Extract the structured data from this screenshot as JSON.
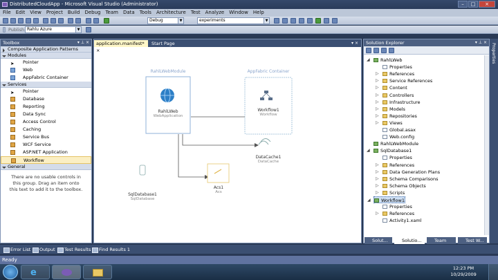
{
  "window": {
    "title": "DistributedCloudApp - Microsoft Visual Studio (Administrator)"
  },
  "menu": [
    "File",
    "Edit",
    "View",
    "Project",
    "Build",
    "Debug",
    "Team",
    "Data",
    "Tools",
    "Architecture",
    "Test",
    "Analyze",
    "Window",
    "Help"
  ],
  "toolbar": {
    "config": "Debug",
    "platform": "experiments",
    "publish_label": "Publish",
    "target": "Rahlu Azure"
  },
  "toolbox": {
    "title": "Toolbox",
    "sections": [
      {
        "label": "Composite Application Patterns",
        "open": false
      },
      {
        "label": "Modules",
        "open": true,
        "items": [
          "Pointer",
          "Web",
          "AppFabric Container"
        ]
      },
      {
        "label": "Services",
        "open": true,
        "items": [
          "Pointer",
          "Database",
          "Reporting",
          "Data Sync",
          "Access Control",
          "Caching",
          "Service Bus",
          "WCF Service",
          "ASP.NET Application",
          "Workflow"
        ]
      },
      {
        "label": "General",
        "open": true
      }
    ],
    "selected": "Workflow",
    "empty_note": "There are no usable controls in this group. Drag an item onto this text to add it to the toolbox."
  },
  "editor": {
    "tabs": [
      "application.manifest*",
      "Start Page"
    ],
    "module_label": "RahlLWebModule",
    "container_label": "AppFabric Container",
    "nodes": {
      "web": {
        "name": "RahlLWeb",
        "sub": "WebApplication"
      },
      "workflow": {
        "name": "Workflow1",
        "sub": "Workflow"
      },
      "cache": {
        "name": "DataCache1",
        "sub": "DataCache"
      },
      "acs": {
        "name": "Acs1",
        "sub": "Acs"
      },
      "sql": {
        "name": "SqlDatabase1",
        "sub": "SqlDatabase"
      }
    }
  },
  "solution": {
    "title": "Solution Explorer",
    "items": [
      {
        "label": "RahlLWeb",
        "level": 0,
        "type": "proj"
      },
      {
        "label": "Properties",
        "level": 1,
        "type": "file"
      },
      {
        "label": "References",
        "level": 1,
        "type": "fold"
      },
      {
        "label": "Service References",
        "level": 1,
        "type": "fold"
      },
      {
        "label": "Content",
        "level": 1,
        "type": "fold"
      },
      {
        "label": "Controllers",
        "level": 1,
        "type": "fold"
      },
      {
        "label": "Infrastructure",
        "level": 1,
        "type": "fold"
      },
      {
        "label": "Models",
        "level": 1,
        "type": "fold"
      },
      {
        "label": "Repositories",
        "level": 1,
        "type": "fold"
      },
      {
        "label": "Views",
        "level": 1,
        "type": "fold"
      },
      {
        "label": "Global.asax",
        "level": 1,
        "type": "file"
      },
      {
        "label": "Web.config",
        "level": 1,
        "type": "file"
      },
      {
        "label": "RahlLWebModule",
        "level": 0,
        "type": "proj"
      },
      {
        "label": "SqlDatabase1",
        "level": 0,
        "type": "proj"
      },
      {
        "label": "Properties",
        "level": 1,
        "type": "file"
      },
      {
        "label": "References",
        "level": 1,
        "type": "fold"
      },
      {
        "label": "Data Generation Plans",
        "level": 1,
        "type": "fold"
      },
      {
        "label": "Schema Comparisons",
        "level": 1,
        "type": "fold"
      },
      {
        "label": "Schema Objects",
        "level": 1,
        "type": "fold"
      },
      {
        "label": "Scripts",
        "level": 1,
        "type": "fold"
      },
      {
        "label": "Workflow1",
        "level": 0,
        "type": "proj"
      },
      {
        "label": "Properties",
        "level": 1,
        "type": "file"
      },
      {
        "label": "References",
        "level": 1,
        "type": "fold"
      },
      {
        "label": "Activity1.xaml",
        "level": 1,
        "type": "file"
      }
    ],
    "bottom_tabs": [
      "Solut...",
      "Solutio...",
      "Team E...",
      "Test W..."
    ]
  },
  "right_strip_label": "Properties",
  "bottom_tabs": [
    "Error List",
    "Output",
    "Test Results",
    "Find Results 1"
  ],
  "status": "Ready",
  "taskbar": {
    "time": "12:23 PM",
    "date": "10/29/2009"
  }
}
